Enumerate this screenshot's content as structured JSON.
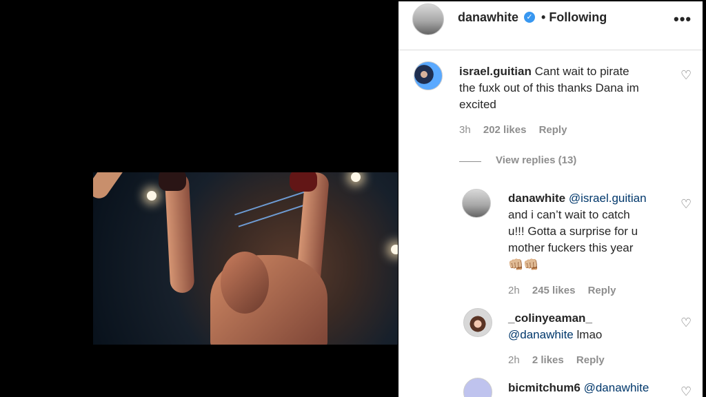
{
  "header": {
    "username": "danawhite",
    "following": "Following",
    "more": "•••"
  },
  "comments": [
    {
      "username": "israel.guitian",
      "text_1": "Cant wait to pirate",
      "text_2": "the fuxk out of this thanks Dana im",
      "text_3": "excited",
      "time": "3h",
      "likes": "202 likes",
      "reply": "Reply"
    }
  ],
  "view_replies": "View replies (13)",
  "replies": [
    {
      "username": "danawhite",
      "mention": "@israel.guitian",
      "text_1": "and i can’t wait to catch",
      "text_2": "u!!! Gotta a surprise for u",
      "text_3": "mother fuckers this year",
      "emoji": "👊🏼👊🏼",
      "time": "2h",
      "likes": "245 likes",
      "reply": "Reply"
    },
    {
      "username": "_colinyeaman_",
      "mention": "@danawhite",
      "text": "lmao",
      "time": "2h",
      "likes": "2 likes",
      "reply": "Reply"
    },
    {
      "username": "bicmitchum6",
      "mention": "@danawhite"
    }
  ],
  "colors": {
    "background": "#000000",
    "panel": "#ffffff",
    "text": "#262626",
    "muted": "#8e8e8e",
    "mention": "#00376b",
    "verified": "#3897f0"
  }
}
